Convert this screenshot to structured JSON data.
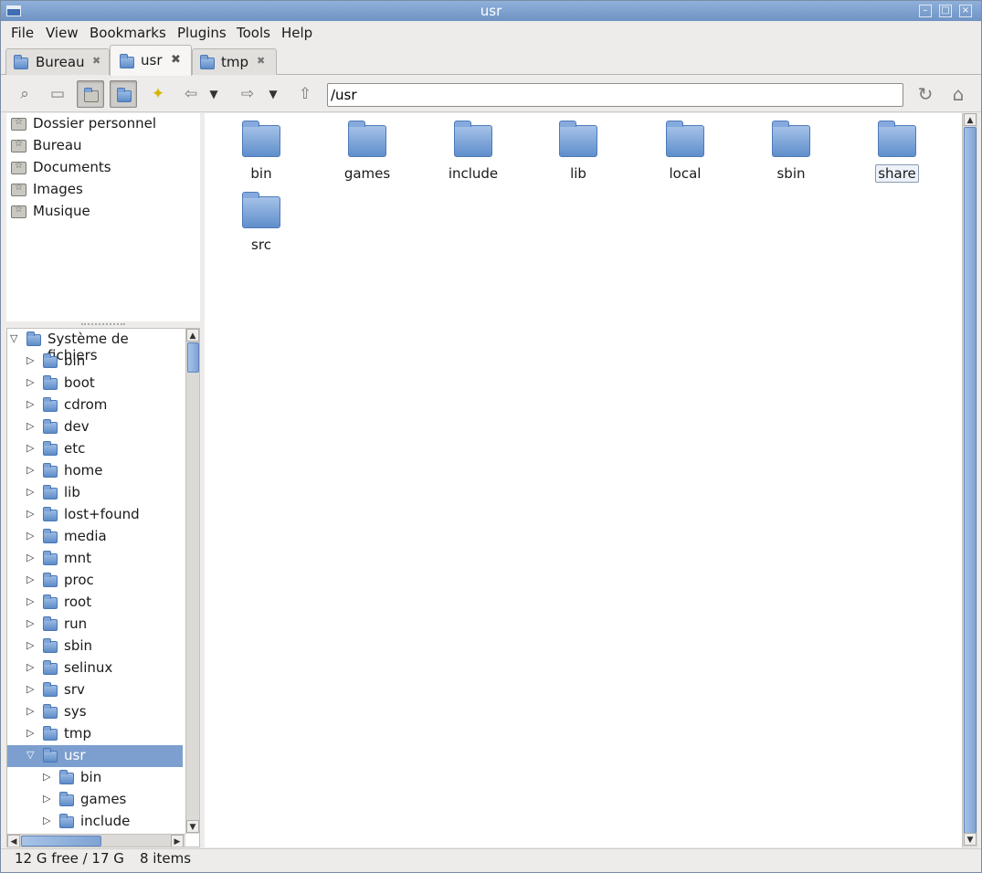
{
  "window": {
    "title": "usr"
  },
  "menubar": [
    "File",
    "View",
    "Bookmarks",
    "Plugins",
    "Tools",
    "Help"
  ],
  "tabs": [
    {
      "label": "Bureau",
      "close": "✖"
    },
    {
      "label": "usr",
      "close": "✖"
    },
    {
      "label": "tmp",
      "close": "✖"
    }
  ],
  "toolbar": {
    "address_value": "/usr",
    "icons": [
      "find-icon",
      "disk-icon",
      "places-icon",
      "tree-icon",
      "bookmark-icon",
      "back-icon",
      "forward-icon",
      "up-icon",
      "reload-icon",
      "home-icon"
    ]
  },
  "places": [
    "Dossier personnel",
    "Bureau",
    "Documents",
    "Images",
    "Musique"
  ],
  "tree": {
    "root": "Système de fichiers",
    "items": [
      "bin",
      "boot",
      "cdrom",
      "dev",
      "etc",
      "home",
      "lib",
      "lost+found",
      "media",
      "mnt",
      "proc",
      "root",
      "run",
      "sbin",
      "selinux",
      "srv",
      "sys",
      "tmp",
      "usr"
    ],
    "selected": "usr",
    "children": [
      "bin",
      "games",
      "include"
    ]
  },
  "files": [
    "bin",
    "games",
    "include",
    "lib",
    "local",
    "sbin",
    "share",
    "src"
  ],
  "selected_file": "share",
  "status": {
    "space": "12 G free / 17 G",
    "count": "8 items"
  }
}
